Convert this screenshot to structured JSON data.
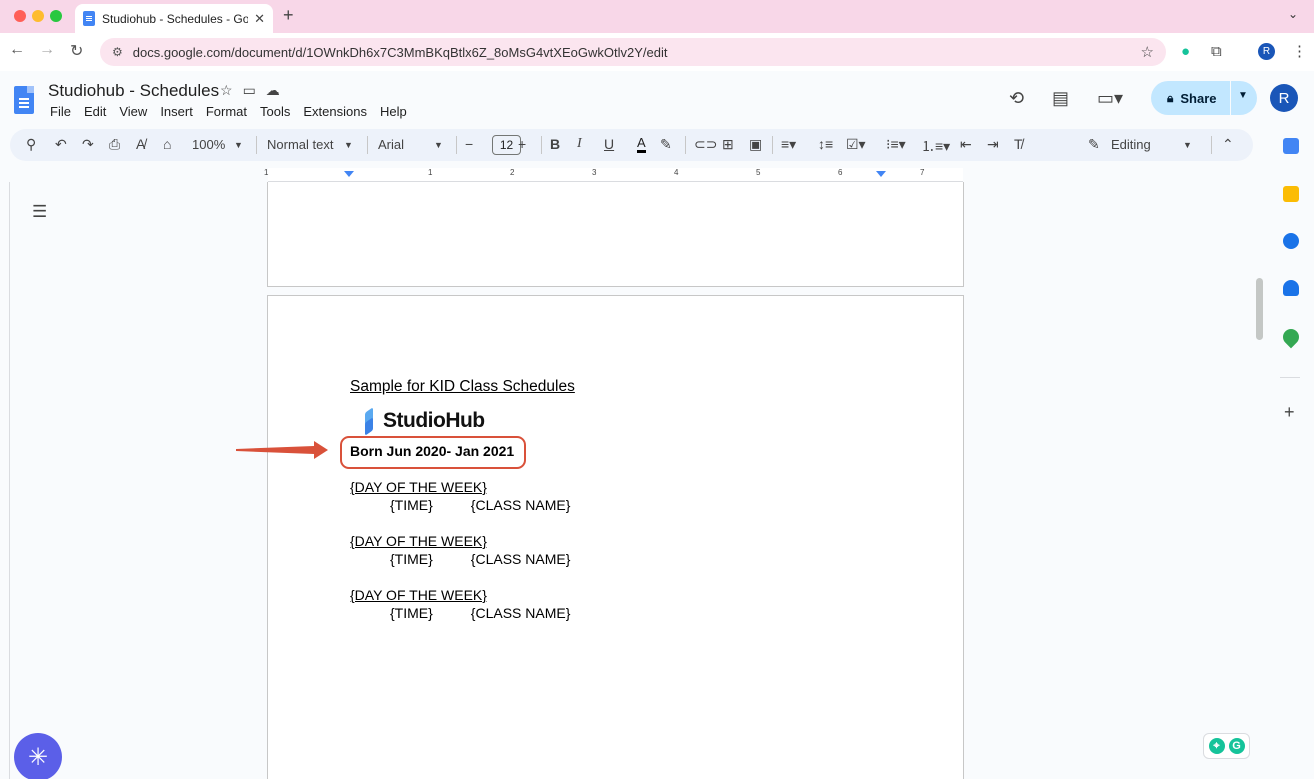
{
  "browser": {
    "tab_title": "Studiohub - Schedules - Goo",
    "tab_close": "✕",
    "new_tab": "+",
    "url": "docs.google.com/document/d/1OWnkDh6x7C3MmBKqBtlx6Z_8oMsG4vtXEoGwkOtlv2Y/edit",
    "profile_initial": "R"
  },
  "docs": {
    "title": "Studiohub - Schedules",
    "menu": [
      "File",
      "Edit",
      "View",
      "Insert",
      "Format",
      "Tools",
      "Extensions",
      "Help"
    ],
    "share_label": "Share",
    "account_initial": "R"
  },
  "toolbar": {
    "zoom": "100%",
    "style": "Normal text",
    "font": "Arial",
    "font_size": "12",
    "mode": "Editing"
  },
  "ruler": {
    "numbers": [
      "1",
      "1",
      "2",
      "3",
      "4",
      "5",
      "6",
      "7"
    ]
  },
  "document": {
    "heading": "Sample for KID Class Schedules",
    "brand": "StudioHub",
    "born_line": "Born Jun 2020- Jan 2021",
    "schedule": [
      {
        "day": "{DAY OF THE WEEK}",
        "time": "{TIME}",
        "class": "{CLASS NAME}"
      },
      {
        "day": "{DAY OF THE WEEK}",
        "time": "{TIME}",
        "class": "{CLASS NAME}"
      },
      {
        "day": "{DAY OF THE WEEK}",
        "time": "{TIME}",
        "class": "{CLASS NAME}"
      }
    ]
  },
  "colors": {
    "highlight_border": "#d9513a",
    "share_bg": "#c2e7ff",
    "tabbar_bg": "#f8d7e8"
  }
}
